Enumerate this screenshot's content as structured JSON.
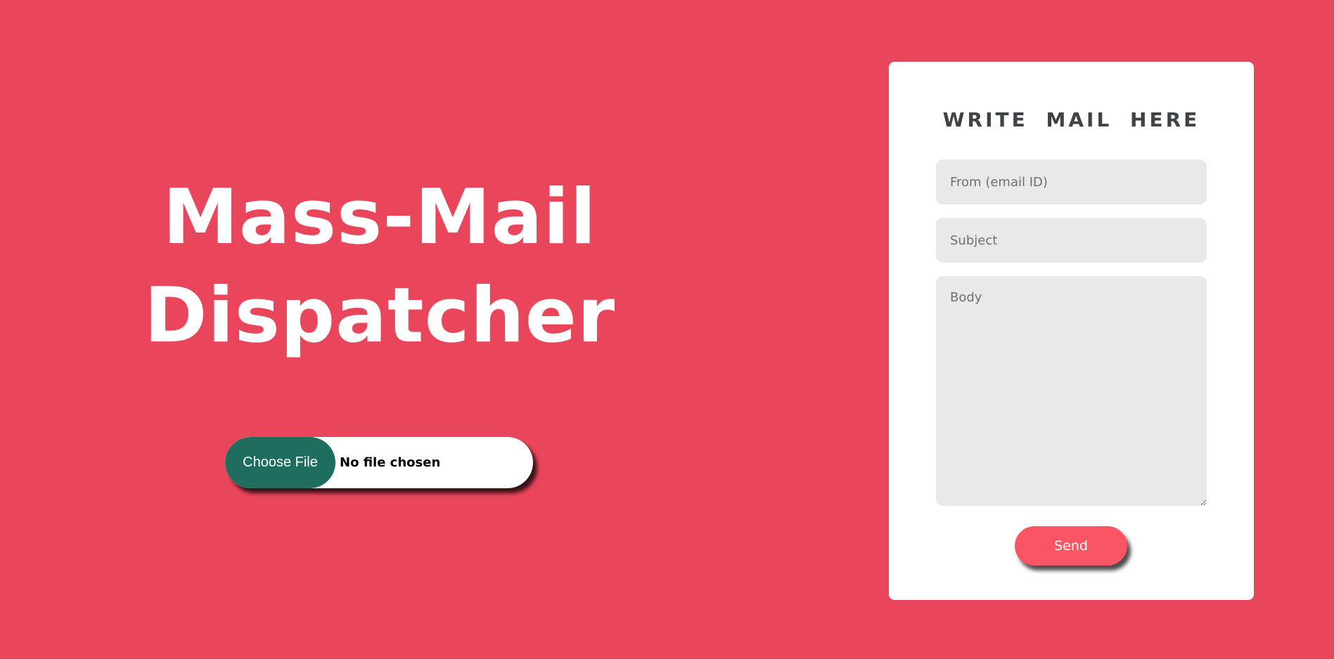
{
  "hero": {
    "title_line1": "Mass-Mail",
    "title_line2": "Dispatcher"
  },
  "file_upload": {
    "button_label": "Choose File",
    "status": "No file chosen"
  },
  "form": {
    "heading": "WRITE MAIL HERE",
    "from_placeholder": "From (email ID)",
    "subject_placeholder": "Subject",
    "body_placeholder": "Body",
    "send_label": "Send"
  },
  "colors": {
    "background": "#EA465B",
    "file_button": "#1F6D5E",
    "send_button": "#FA5565",
    "card": "#FFFFFF",
    "field": "#E9E9E9"
  }
}
